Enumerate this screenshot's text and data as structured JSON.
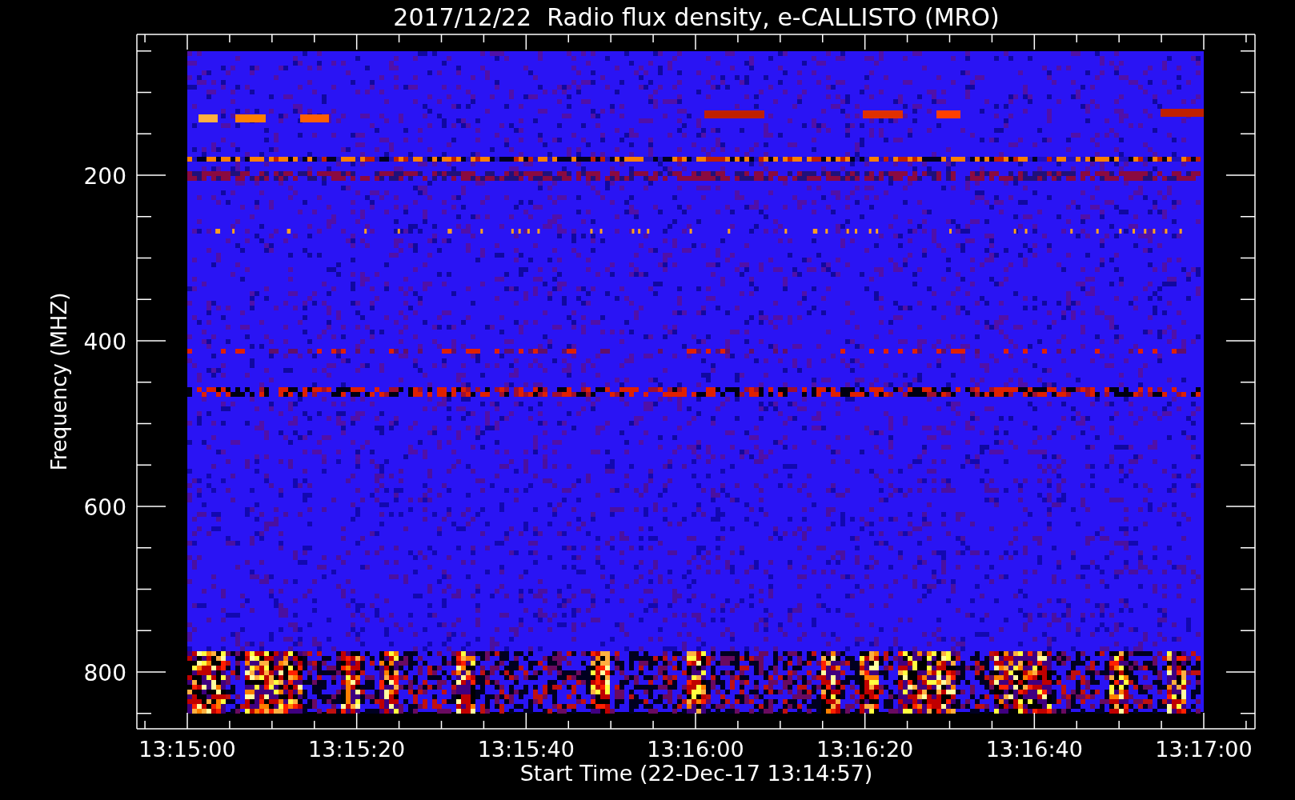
{
  "title": "2017/12/22  Radio flux density, e-CALLISTO (MRO)",
  "y_axis": {
    "label": "Frequency (MHZ)",
    "ticks": [
      "200",
      "400",
      "600",
      "800"
    ]
  },
  "x_axis": {
    "label": "Start Time (22-Dec-17 13:14:57)",
    "ticks": [
      "13:15:00",
      "13:15:20",
      "13:15:40",
      "13:16:00",
      "13:16:20",
      "13:16:40",
      "13:17:00"
    ]
  }
}
